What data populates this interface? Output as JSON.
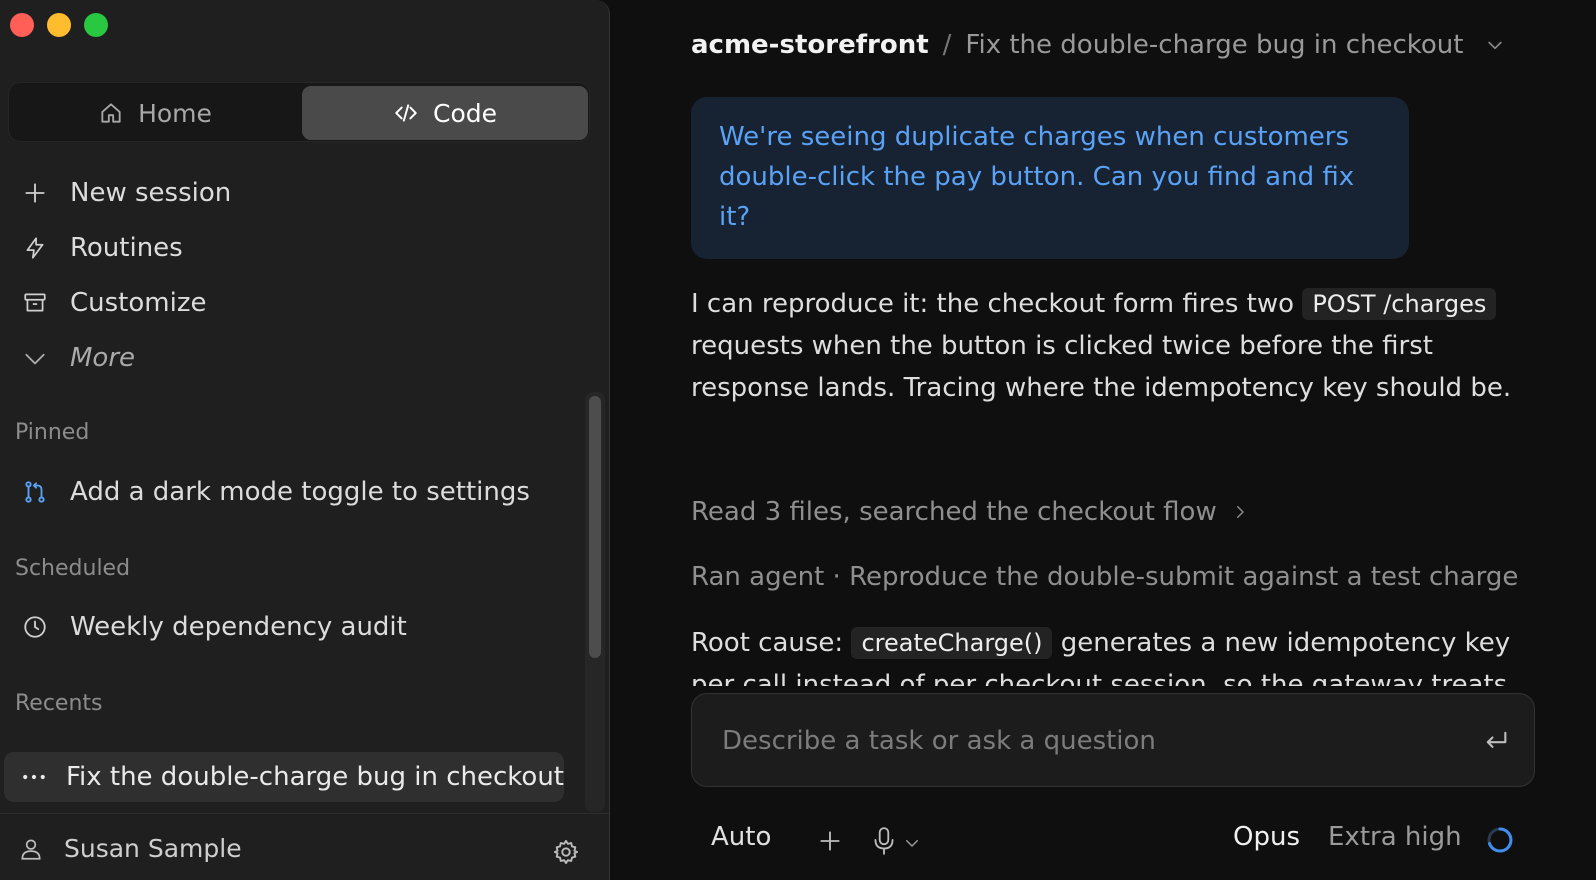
{
  "sidebar": {
    "mode_tabs": [
      {
        "label": "Home",
        "icon": "home-icon",
        "active": false
      },
      {
        "label": "Code",
        "icon": "code-icon",
        "active": true
      }
    ],
    "nav": [
      {
        "label": "New session",
        "icon": "plus-icon"
      },
      {
        "label": "Routines",
        "icon": "bolt-icon"
      },
      {
        "label": "Customize",
        "icon": "archive-icon"
      },
      {
        "label": "More",
        "icon": "chevron-down-icon"
      }
    ],
    "pinned_label": "Pinned",
    "pinned": [
      {
        "label": "Add a dark mode toggle to settings",
        "icon": "pull-request-icon"
      }
    ],
    "scheduled_label": "Scheduled",
    "scheduled": [
      {
        "label": "Weekly dependency audit",
        "icon": "clock-icon"
      }
    ],
    "recents_label": "Recents",
    "recents": [
      {
        "label": "Fix the double-charge bug in checkout",
        "icon": "ellipsis-icon",
        "active": true
      }
    ],
    "user_name": "Susan Sample"
  },
  "main": {
    "breadcrumb": {
      "repo": "acme-storefront",
      "separator": "/",
      "title": "Fix the double-charge bug in checkout"
    },
    "user_message": "We're seeing duplicate charges when customers double-click the pay button. Can you find and fix it?",
    "assistant_1": {
      "before": "I can reproduce it: the checkout form fires two ",
      "code": "POST /charges",
      "after": " requests when the button is clicked twice before the first response lands. Tracing where the idempotency key should be."
    },
    "tool_summary": "Read 3 files, searched the checkout flow",
    "agent_line": "Ran agent · Reproduce the double-submit against a test charge",
    "assistant_2": {
      "before": "Root cause: ",
      "code": "createCharge()",
      "after": " generates a new idempotency key per call instead of per checkout session, so the gateway treats"
    },
    "composer": {
      "placeholder": "Describe a task or ask a question"
    },
    "toolbar": {
      "mode": "Auto",
      "model": "Opus",
      "effort": "Extra high"
    }
  },
  "colors": {
    "accent": "#5aa2f5",
    "bubble_bg": "#172232",
    "sidebar_bg": "#1f1f1f",
    "main_bg": "#0f0f0f"
  }
}
